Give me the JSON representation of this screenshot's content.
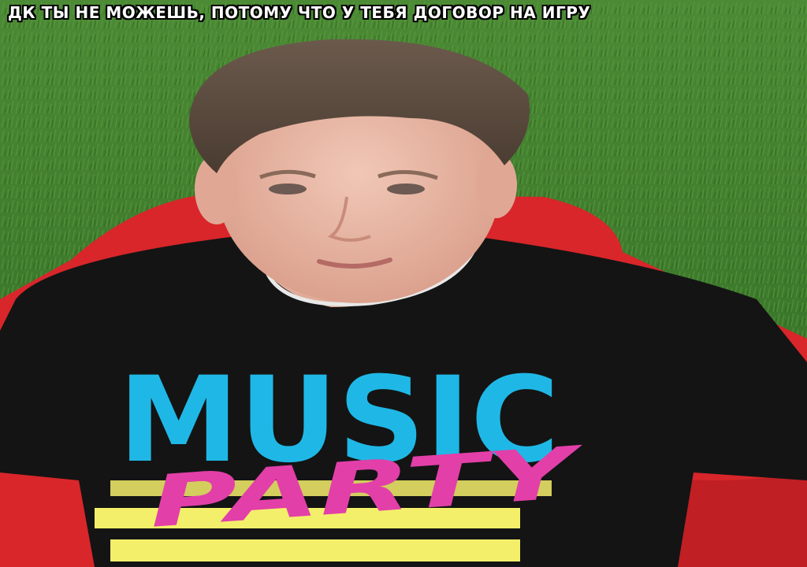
{
  "caption": "ДК ТЫ НЕ МОЖЕШЬ, ПОТОМУ ЧТО У ТЕБЯ ДОГОВОР НА ИГРУ",
  "shirt": {
    "line1": "MUSIC",
    "line2": "PARTY",
    "colors": {
      "music": "#1fb8e6",
      "party": "#e23fa9",
      "stripes": "#f4ef6a"
    }
  },
  "colors": {
    "grass": "#3f7a2c",
    "chair": "#d8262a",
    "shirt": "#141414",
    "skin": "#e8b9a8",
    "hair": "#5a4a3f"
  }
}
